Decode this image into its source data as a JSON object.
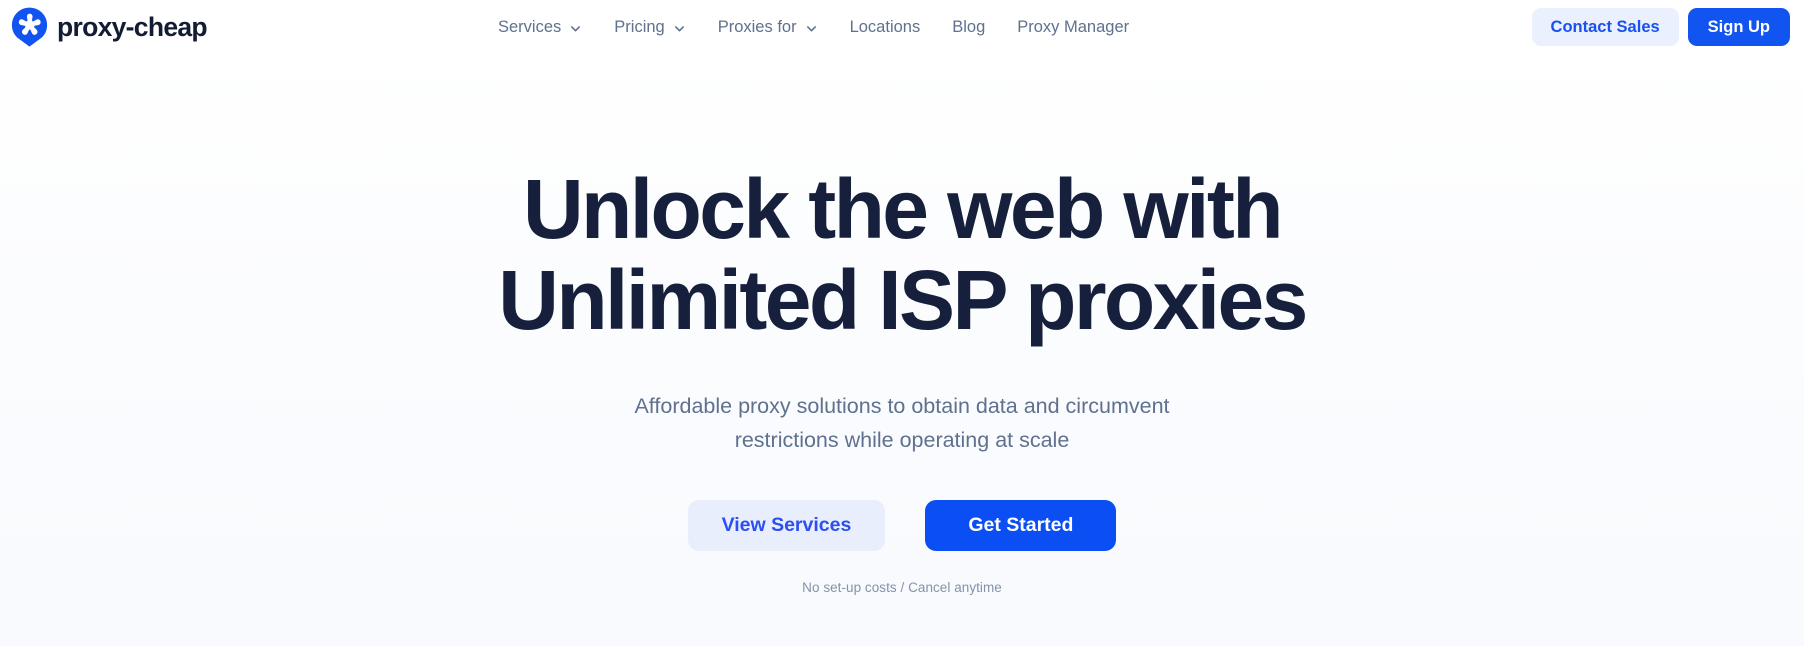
{
  "brand": {
    "name": "proxy-cheap",
    "logo_icon": "location-pin-asterisk-icon",
    "logo_color": "#1254f0"
  },
  "header": {
    "nav_items": [
      {
        "label": "Services",
        "has_dropdown": true,
        "icon": "chevron-down-icon"
      },
      {
        "label": "Pricing",
        "has_dropdown": true,
        "icon": "chevron-down-icon"
      },
      {
        "label": "Proxies for",
        "has_dropdown": true,
        "icon": "chevron-down-icon"
      },
      {
        "label": "Locations",
        "has_dropdown": false,
        "icon": ""
      },
      {
        "label": "Blog",
        "has_dropdown": false,
        "icon": ""
      },
      {
        "label": "Proxy Manager",
        "has_dropdown": false,
        "icon": ""
      }
    ],
    "contact_sales_label": "Contact Sales",
    "sign_up_label": "Sign Up"
  },
  "hero": {
    "title_line1": "Unlock the web with",
    "title_line2": "Unlimited ISP proxies",
    "subtitle_line1": "Affordable proxy solutions to obtain data and circumvent",
    "subtitle_line2": "restrictions while operating at scale",
    "primary_cta_label": "Get Started",
    "secondary_cta_label": "View Services",
    "note": "No set-up costs / Cancel anytime"
  },
  "colors": {
    "brand_blue": "#1254f0",
    "primary_button": "#0b4ef3",
    "soft_button_bg": "#e9eefd",
    "heading_navy": "#16203c",
    "body_slate": "#5f718e",
    "muted_note": "#8492ab",
    "page_bg": "#fcfdfe"
  }
}
